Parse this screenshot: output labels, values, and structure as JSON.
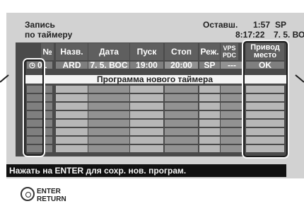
{
  "header": {
    "title_line1": "Запись",
    "title_line2": "по таймеру",
    "remain_label": "Оставш.",
    "remain_time": "1:57",
    "remain_mode": "SP",
    "clock": "8:17:22",
    "clock_date": "7. 5. ВОС"
  },
  "table": {
    "columns": {
      "num": "№",
      "name": "Назв.",
      "date": "Дата",
      "start": "Пуск",
      "stop": "Стоп",
      "mode": "Реж.",
      "vps_line1": "VPS",
      "vps_line2": "PDC",
      "drive_line1": "Привод",
      "drive_line2": "место"
    },
    "rows": [
      {
        "num": "01",
        "name": "ARD",
        "date": "7. 5. ВОС",
        "start": "19:00",
        "stop": "20:00",
        "mode": "SP",
        "vps": "---",
        "drive": "OK"
      }
    ],
    "new_program": "Программа нового таймера"
  },
  "status_message": "Нажать на ENTER для сохр. нов. програм.",
  "footer": {
    "enter_label": "ENTER",
    "return_label": "RETURN"
  },
  "icons": {
    "timer": "clock-icon",
    "remote": "remote-dpad-icon"
  }
}
